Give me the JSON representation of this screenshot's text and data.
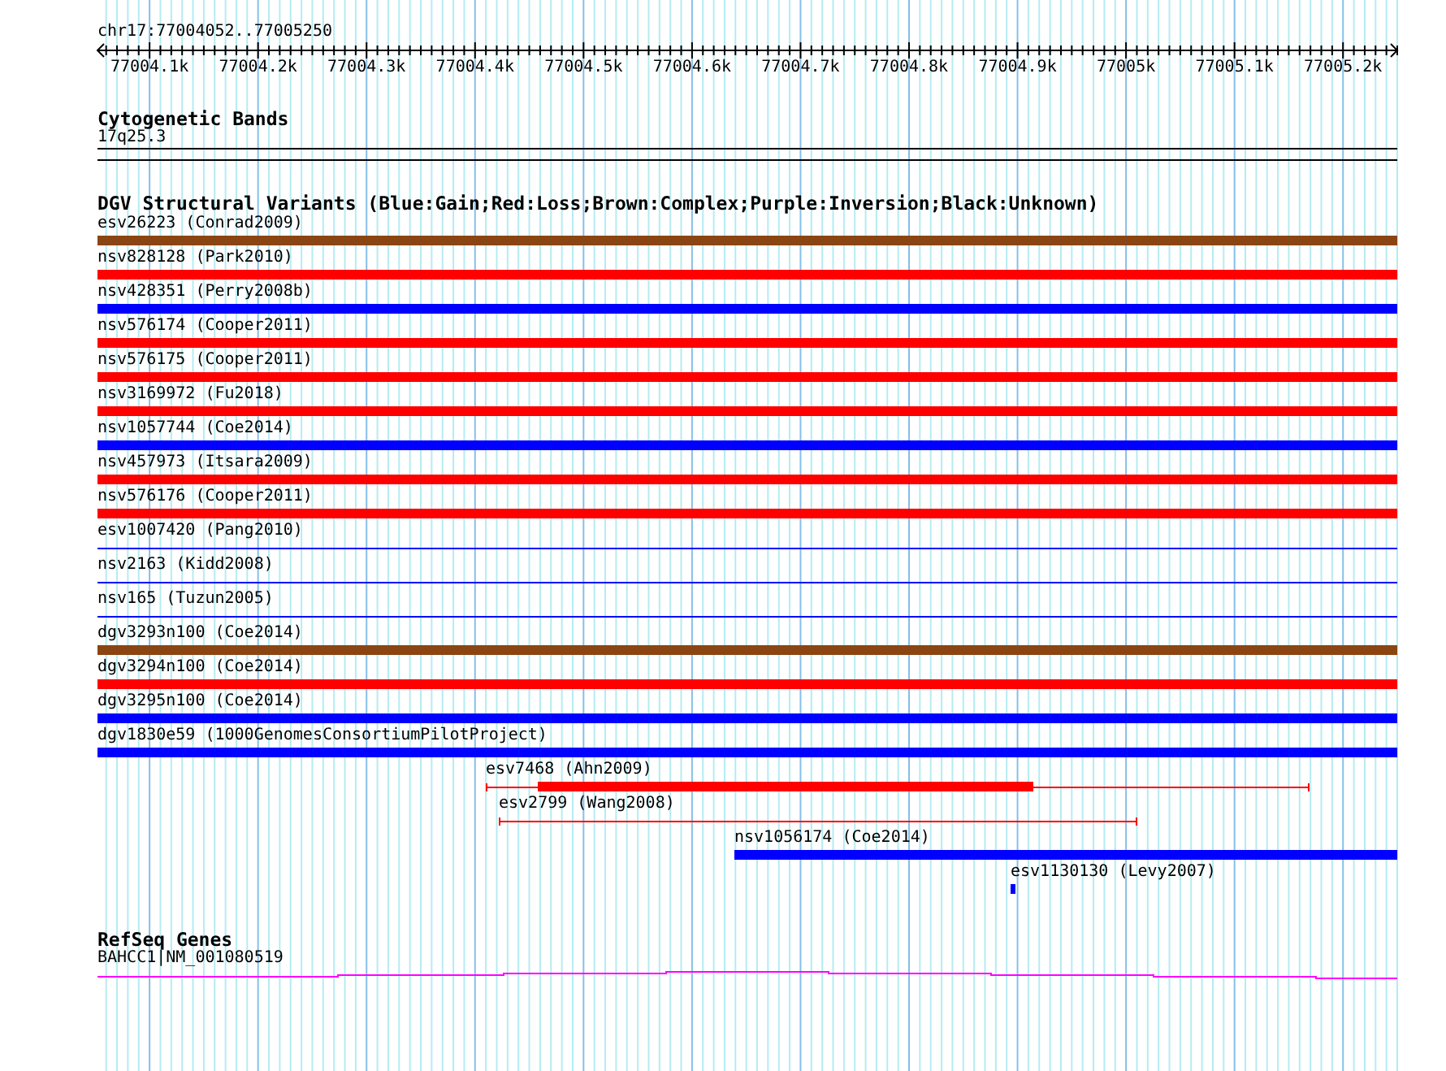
{
  "locus": "chr17:77004052..77005250",
  "ruler": {
    "tick_labels": [
      "77004.1k",
      "77004.2k",
      "77004.3k",
      "77004.4k",
      "77004.5k",
      "77004.6k",
      "77004.7k",
      "77004.8k",
      "77004.9k",
      "77005k",
      "77005.1k",
      "77005.2k"
    ]
  },
  "cytoband_track": {
    "title": "Cytogenetic Bands",
    "label": "17q25.3"
  },
  "variant_track": {
    "title": "DGV Structural Variants (Blue:Gain;Red:Loss;Brown:Complex;Purple:Inversion;Black:Unknown)",
    "features": [
      {
        "label": "esv26223 (Conrad2009)",
        "color": "#8b4513",
        "kind": "full-bar"
      },
      {
        "label": "nsv828128 (Park2010)",
        "color": "#ff0000",
        "kind": "full-bar"
      },
      {
        "label": "nsv428351 (Perry2008b)",
        "color": "#0000ff",
        "kind": "full-bar"
      },
      {
        "label": "nsv576174 (Cooper2011)",
        "color": "#ff0000",
        "kind": "full-bar"
      },
      {
        "label": "nsv576175 (Cooper2011)",
        "color": "#ff0000",
        "kind": "full-bar"
      },
      {
        "label": "nsv3169972 (Fu2018)",
        "color": "#ff0000",
        "kind": "full-bar"
      },
      {
        "label": "nsv1057744 (Coe2014)",
        "color": "#0000ff",
        "kind": "full-bar"
      },
      {
        "label": "nsv457973 (Itsara2009)",
        "color": "#ff0000",
        "kind": "full-bar"
      },
      {
        "label": "nsv576176 (Cooper2011)",
        "color": "#ff0000",
        "kind": "full-bar"
      },
      {
        "label": "esv1007420 (Pang2010)",
        "color": "#0000ff",
        "kind": "full-line"
      },
      {
        "label": "nsv2163 (Kidd2008)",
        "color": "#0000ff",
        "kind": "full-line"
      },
      {
        "label": "nsv165 (Tuzun2005)",
        "color": "#0000ff",
        "kind": "full-line"
      },
      {
        "label": "dgv3293n100 (Coe2014)",
        "color": "#8b4513",
        "kind": "full-bar"
      },
      {
        "label": "dgv3294n100 (Coe2014)",
        "color": "#ff0000",
        "kind": "full-bar"
      },
      {
        "label": "dgv3295n100 (Coe2014)",
        "color": "#0000ff",
        "kind": "full-bar"
      },
      {
        "label": "dgv1830e59 (1000GenomesConsortiumPilotProject)",
        "color": "#0000ff",
        "kind": "full-bar"
      },
      {
        "label": "esv7468 (Ahn2009)",
        "color": "#ff0000",
        "kind": "partial-mixed"
      },
      {
        "label": "esv2799 (Wang2008)",
        "color": "#ff0000",
        "kind": "partial-line"
      },
      {
        "label": "nsv1056174 (Coe2014)",
        "color": "#0000ff",
        "kind": "partial-bar"
      },
      {
        "label": "esv1130130 (Levy2007)",
        "color": "#0000ff",
        "kind": "partial-bar"
      }
    ]
  },
  "gene_track": {
    "title": "RefSeq Genes",
    "label": "BAHCC1|NM_001080519"
  }
}
